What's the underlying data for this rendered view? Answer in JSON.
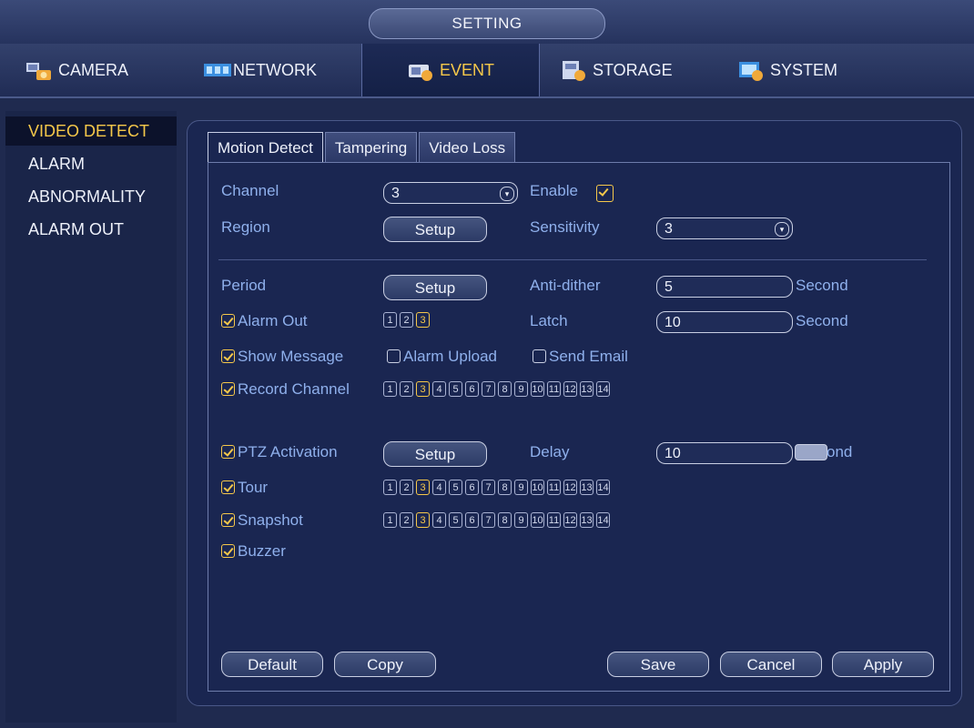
{
  "window": {
    "title": "SETTING"
  },
  "main_tabs": [
    {
      "label": "CAMERA",
      "icon": "camera-icon"
    },
    {
      "label": "NETWORK",
      "icon": "network-icon"
    },
    {
      "label": "EVENT",
      "icon": "event-icon"
    },
    {
      "label": "STORAGE",
      "icon": "storage-icon"
    },
    {
      "label": "SYSTEM",
      "icon": "system-icon"
    }
  ],
  "sidebar": {
    "items": [
      {
        "label": "VIDEO DETECT"
      },
      {
        "label": "ALARM"
      },
      {
        "label": "ABNORMALITY"
      },
      {
        "label": "ALARM OUT"
      }
    ]
  },
  "sub_tabs": [
    {
      "label": "Motion Detect"
    },
    {
      "label": "Tampering"
    },
    {
      "label": "Video Loss"
    }
  ],
  "form": {
    "channel_label": "Channel",
    "channel_value": "3",
    "enable_label": "Enable",
    "region_label": "Region",
    "setup_label": "Setup",
    "sensitivity_label": "Sensitivity",
    "sensitivity_value": "3",
    "period_label": "Period",
    "anti_dither_label": "Anti-dither",
    "anti_dither_value": "5",
    "second_label": "Second",
    "alarm_out_label": "Alarm Out",
    "alarm_out_channels": [
      "1",
      "2",
      "3"
    ],
    "latch_label": "Latch",
    "latch_value": "10",
    "show_message_label": "Show Message",
    "alarm_upload_label": "Alarm Upload",
    "send_email_label": "Send Email",
    "record_channel_label": "Record Channel",
    "ptz_activation_label": "PTZ Activation",
    "delay_label": "Delay",
    "delay_value": "10",
    "delay_unit_partial": "ond",
    "tour_label": "Tour",
    "snapshot_label": "Snapshot",
    "buzzer_label": "Buzzer",
    "channels": [
      "1",
      "2",
      "3",
      "4",
      "5",
      "6",
      "7",
      "8",
      "9",
      "10",
      "11",
      "12",
      "13",
      "14"
    ]
  },
  "buttons": {
    "default": "Default",
    "copy": "Copy",
    "save": "Save",
    "cancel": "Cancel",
    "apply": "Apply"
  },
  "colors": {
    "accent_active": "#f6c84a",
    "background": "#1f2a4f"
  }
}
